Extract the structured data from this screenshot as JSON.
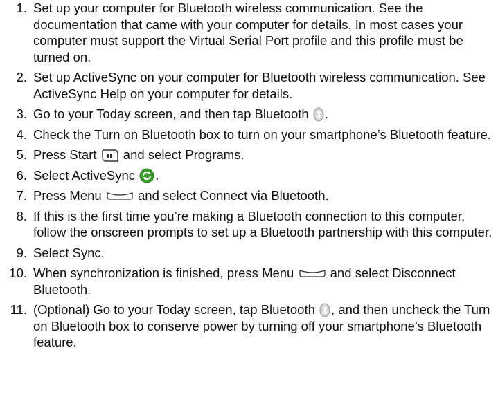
{
  "steps": [
    {
      "n": "1.",
      "text": "Set up your computer for Bluetooth wireless communication. See the documentation that came with your computer for details. In most cases your computer must support the Virtual Serial Port profile and this profile must be turned on."
    },
    {
      "n": "2.",
      "text": "Set up ActiveSync on your computer for Bluetooth wireless communication. See ActiveSync Help on your computer for details."
    },
    {
      "n": "3.",
      "a": "Go to your Today screen, and then tap Bluetooth",
      "b": "."
    },
    {
      "n": "4.",
      "text": "Check the Turn on Bluetooth box to turn on your smartphone’s Bluetooth feature."
    },
    {
      "n": "5.",
      "a": "Press Start",
      "b": "and select Programs."
    },
    {
      "n": "6.",
      "a": "Select ActiveSync",
      "b": "."
    },
    {
      "n": "7.",
      "a": "Press Menu",
      "b": "and select Connect via Bluetooth."
    },
    {
      "n": "8.",
      "text": "If this is the first time you’re making a Bluetooth connection to this computer, follow the onscreen prompts to set up a Bluetooth partnership with this computer."
    },
    {
      "n": "9.",
      "text": "Select Sync."
    },
    {
      "n": "10.",
      "a": "When synchronization is finished, press Menu",
      "b": "and select Disconnect Bluetooth."
    },
    {
      "n": "11.",
      "a": "(Optional) Go to your Today screen, tap Bluetooth",
      "b": ", and then uncheck the Turn on Bluetooth box to conserve power by turning off your smartphone’s Bluetooth feature."
    }
  ],
  "icons": {
    "step3": "bluetooth-icon",
    "step5": "start-key-icon",
    "step6": "activesync-icon",
    "step7": "menu-softkey-icon",
    "step10": "menu-softkey-icon",
    "step11": "bluetooth-icon"
  },
  "colors": {
    "text": "#111111",
    "activesync_green": "#3a9d2e",
    "bluetooth_grey": "#c9c9c9"
  }
}
